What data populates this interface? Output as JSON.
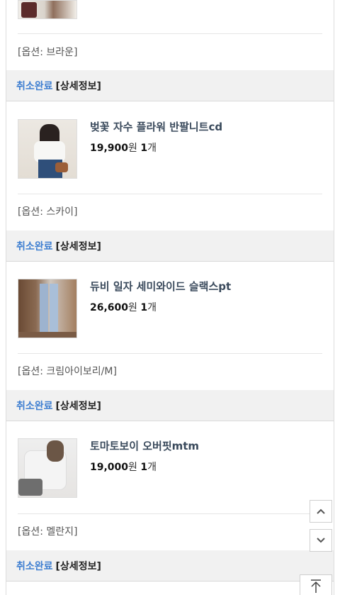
{
  "orders": [
    {
      "option": "[옵션: 브라운]",
      "status": "취소완료",
      "detail": "[상세정보]"
    },
    {
      "title": "벚꽃 자수 플라워 반팔니트cd",
      "price": "19,900",
      "price_unit": "원",
      "qty": "1",
      "qty_unit": "개",
      "option": "[옵션: 스카이]",
      "status": "취소완료",
      "detail": "[상세정보]"
    },
    {
      "title": "듀비 일자 세미와이드 슬랙스pt",
      "price": "26,600",
      "price_unit": "원",
      "qty": "1",
      "qty_unit": "개",
      "option": "[옵션: 크림아이보리/M]",
      "status": "취소완료",
      "detail": "[상세정보]"
    },
    {
      "title": "토마토보이 오버핏mtm",
      "price": "19,000",
      "price_unit": "원",
      "qty": "1",
      "qty_unit": "개",
      "option": "[옵션: 멜란지]",
      "status": "취소완료",
      "detail": "[상세정보]"
    }
  ],
  "colors": {
    "status": "#3f7fd1",
    "title": "#3a4a5c",
    "bar_bg": "#f1f1f1"
  },
  "icons": {
    "scroll_up": "chevron-up-icon",
    "scroll_down": "chevron-down-icon",
    "back_to_top": "arrow-up-to-top-icon"
  }
}
